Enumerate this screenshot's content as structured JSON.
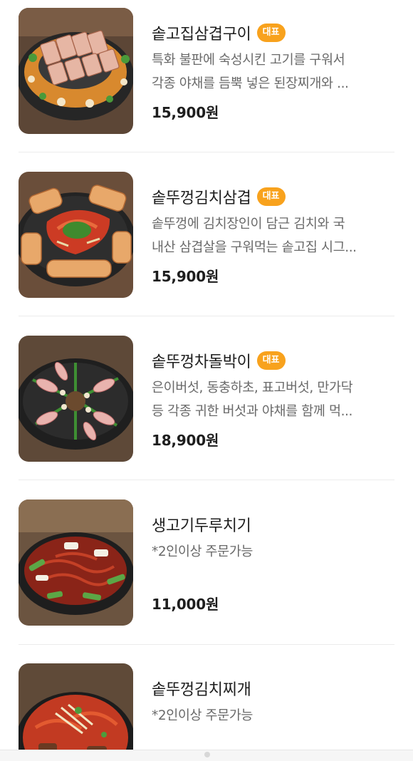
{
  "menu": {
    "items": [
      {
        "name": "솥고집삼겹구이",
        "badge": "대표",
        "desc_line1": "특화 불판에 숙성시킨 고기를 구워서",
        "desc_line2": "각종 야채를 듬뿍 넣은 된장찌개와 ...",
        "price": "15,900원",
        "image": "pork-belly-grill-dish"
      },
      {
        "name": "솥뚜껑김치삼겹",
        "badge": "대표",
        "desc_line1": "솥뚜껑에 김치장인이 담근 김치와 국",
        "desc_line2": "내산 삼겹살을 구워먹는 솥고집 시그...",
        "price": "15,900원",
        "image": "kimchi-pork-belly-dish"
      },
      {
        "name": "솥뚜껑차돌박이",
        "badge": "대표",
        "desc_line1": "은이버섯, 동충하초, 표고버섯, 만가닥",
        "desc_line2": "등 각종 귀한 버섯과 야채를 함께 먹...",
        "price": "18,900원",
        "image": "brisket-mushroom-dish"
      },
      {
        "name": "생고기두루치기",
        "badge": "",
        "desc_line1": "*2인이상 주문가능",
        "desc_line2": "",
        "price": "11,000원",
        "image": "spicy-stir-fried-pork-dish"
      },
      {
        "name": "솥뚜껑김치찌개",
        "badge": "",
        "desc_line1": "*2인이상 주문가능",
        "desc_line2": "",
        "price": "",
        "image": "kimchi-stew-dish"
      }
    ]
  },
  "colors": {
    "badge": "#f8a21d",
    "text_primary": "#1e1e1e",
    "text_secondary": "#6a6a6a",
    "divider": "#ececec"
  }
}
